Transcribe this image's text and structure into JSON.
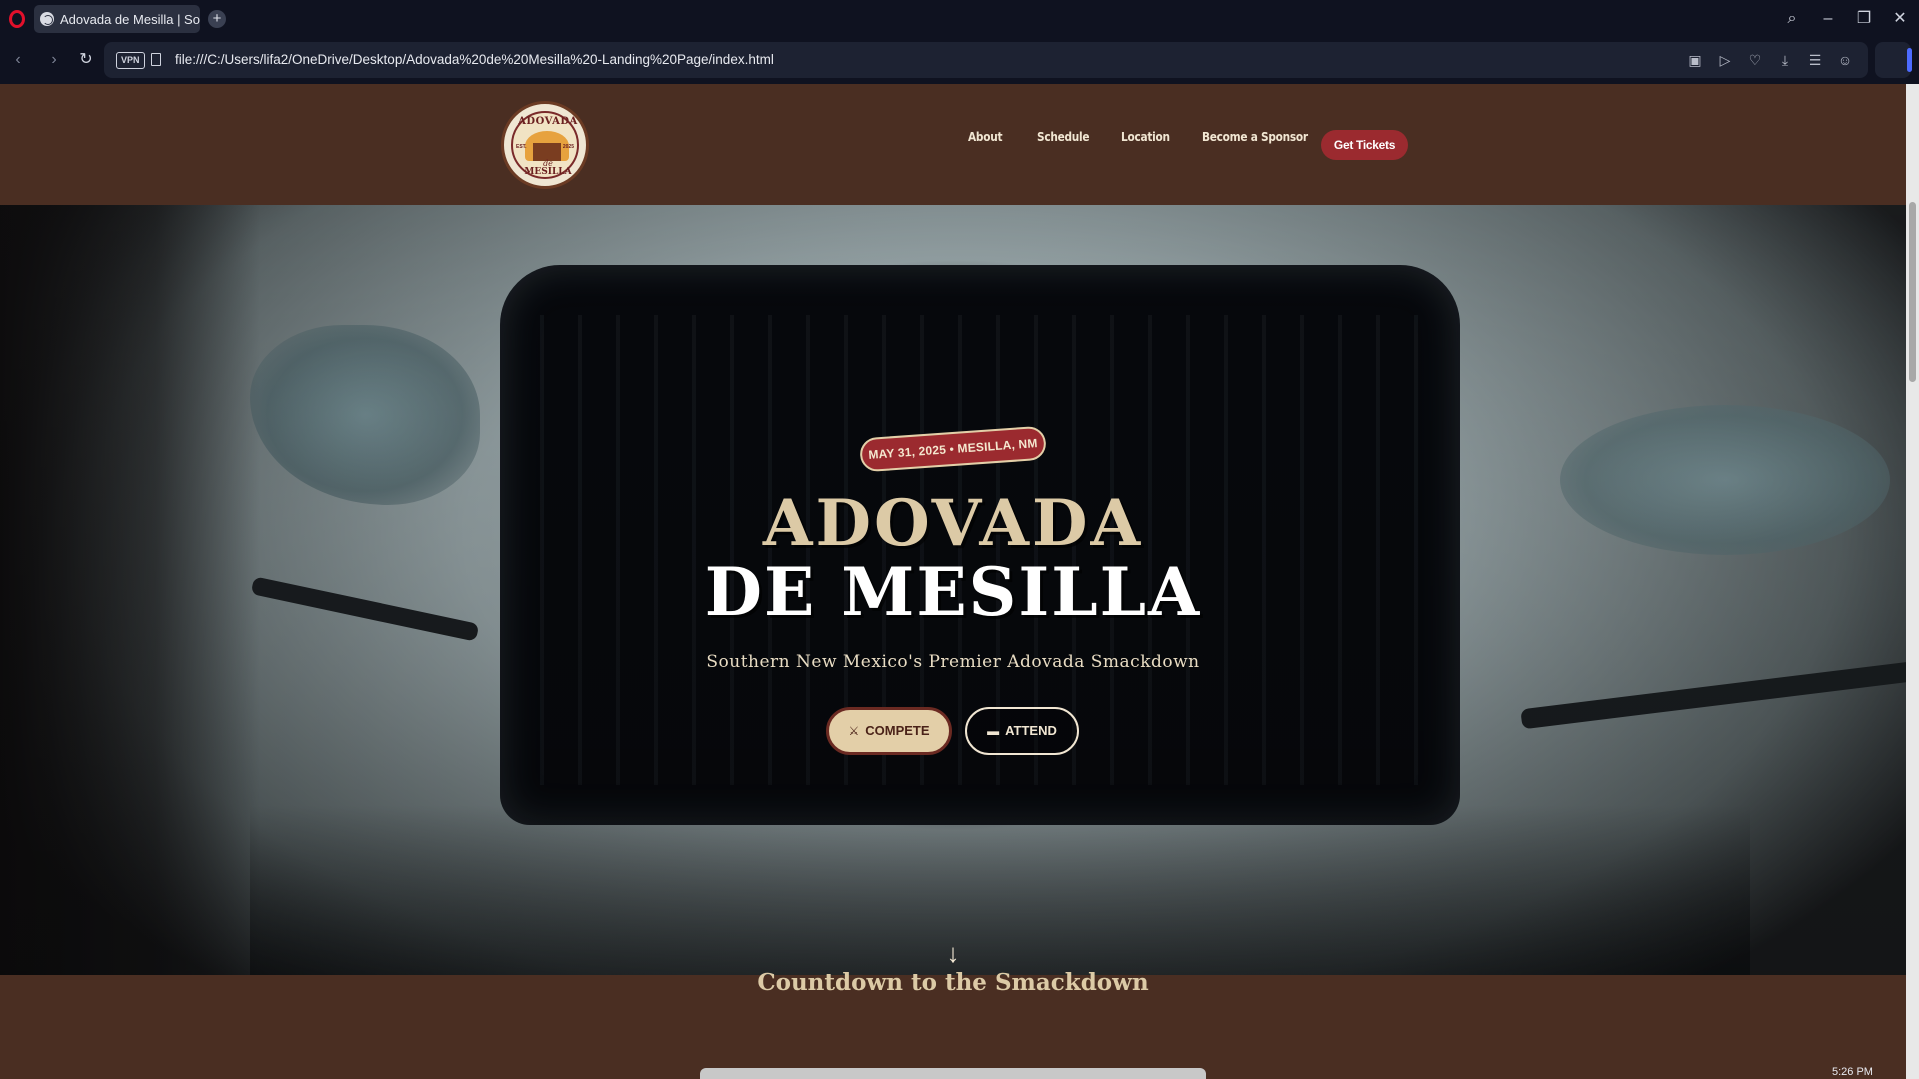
{
  "browser": {
    "tab_title": "Adovada de Mesilla | Sout",
    "new_tab_glyph": "+",
    "url": "file:///C:/Users/lifa2/OneDrive/Desktop/Adovada%20de%20Mesilla%20-Landing%20Page/index.html",
    "vpn_label": "VPN",
    "clock": "5:26 PM"
  },
  "logo": {
    "top_text": "ADOVADA",
    "middle_text": "de",
    "bottom_text": "MESILLA",
    "est": "EST.",
    "year": "2025"
  },
  "nav": {
    "items": [
      "About",
      "Schedule",
      "Location",
      "Become a Sponsor"
    ],
    "cta": "Get Tickets"
  },
  "hero": {
    "badge": "MAY 31, 2025 • MESILLA, NM",
    "title_line1": "ADOVADA",
    "title_line2": "DE MESILLA",
    "subtitle": "Southern New Mexico's Premier Adovada Smackdown",
    "buttons": {
      "compete": "COMPETE",
      "attend": "ATTEND"
    },
    "scroll_glyph": "↓"
  },
  "countdown": {
    "title": "Countdown to the Smackdown"
  },
  "colors": {
    "header_bg": "#4a2e22",
    "accent_red": "#9b2a2f",
    "cream": "#dccaa6"
  }
}
